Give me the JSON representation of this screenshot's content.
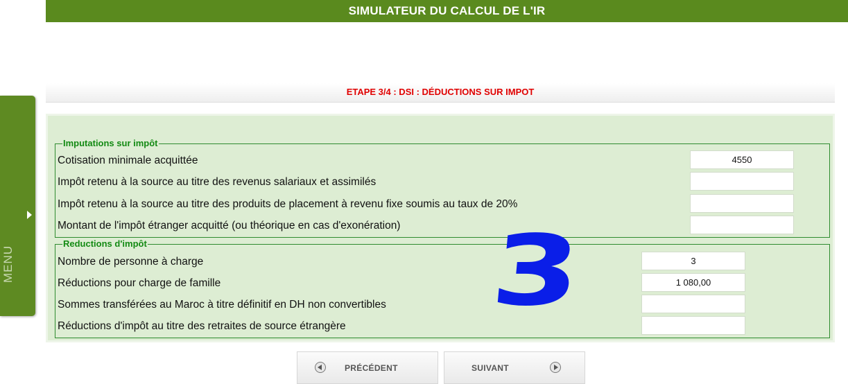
{
  "header": {
    "title": "SIMULATEUR DU CALCUL DE L'IR"
  },
  "side_menu": {
    "label": "MENU",
    "arrow_icon": "chevron-right-icon"
  },
  "step": {
    "title": "ETAPE 3/4 : DSI : DÉDUCTIONS SUR IMPOT"
  },
  "imputations": {
    "legend": "Imputations sur impôt",
    "rows": [
      {
        "label": "Cotisation minimale acquittée",
        "value": "4550"
      },
      {
        "label": "Impôt retenu à la source au titre des revenus salariaux et assimilés",
        "value": ""
      },
      {
        "label": "Impôt retenu à la source au titre des produits de placement à revenu fixe soumis au taux de 20%",
        "value": ""
      },
      {
        "label": "Montant de l'impôt étranger acquitté (ou théorique en cas d'exonération)",
        "value": ""
      }
    ]
  },
  "reductions": {
    "legend": "Reductions d'impôt",
    "rows": [
      {
        "label": "Nombre de personne à charge",
        "value": "3"
      },
      {
        "label": "Réductions pour charge de famille",
        "value": "1 080,00"
      },
      {
        "label": "Sommes transférées au Maroc à titre définitif en DH non convertibles",
        "value": ""
      },
      {
        "label": "Réductions d'impôt au titre des retraites de source étrangère",
        "value": ""
      }
    ]
  },
  "overlay_number": "3",
  "overlay_color": "#0a1ee8",
  "navigation": {
    "previous_label": "PRÉCÉDENT",
    "next_label": "SUIVANT",
    "previous_icon": "arrow-left-circle-icon",
    "next_icon": "arrow-right-circle-icon"
  },
  "colors": {
    "header_green": "#5a8a1e",
    "step_red": "#e00000",
    "legend_green": "#138a13",
    "panel_bg": "#ddedd3"
  }
}
